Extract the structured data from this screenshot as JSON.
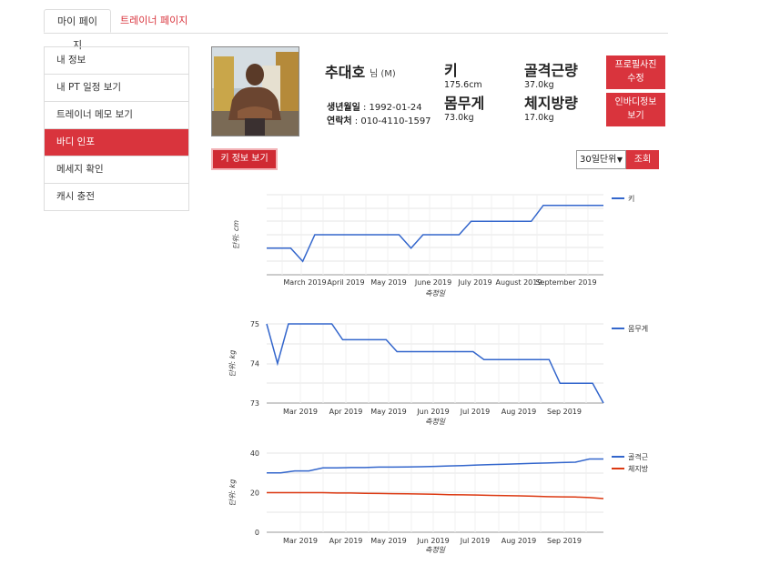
{
  "tabs": {
    "mypage": "마이 페이지",
    "trainer": "트레이너 페이지"
  },
  "sidebar": {
    "items": [
      {
        "label": "내 정보"
      },
      {
        "label": "내 PT 일정 보기"
      },
      {
        "label": "트레이너 메모 보기"
      },
      {
        "label": "바디 인포"
      },
      {
        "label": "메세지 확인"
      },
      {
        "label": "캐시 충전"
      }
    ]
  },
  "profile": {
    "name": "추대호",
    "suffix": "님 (M)",
    "birth_label": "생년월일",
    "birth": " : 1992-01-24",
    "phone_label": "연락처",
    "phone": " : 010-4110-1597"
  },
  "metrics": {
    "height_title": "키",
    "height_value": "175.6cm",
    "muscle_title": "골격근량",
    "muscle_value": "37.0kg",
    "weight_title": "몸무게",
    "weight_value": "73.0kg",
    "fat_title": "체지방량",
    "fat_value": "17.0kg"
  },
  "buttons": {
    "photo_edit_1": "프로필사진",
    "photo_edit_2": "수정",
    "inbody_edit_1": "인바디정보",
    "inbody_edit_2": "보기",
    "view_height": "키 정보 보기",
    "period_select": "30일단위",
    "search": "조회"
  },
  "colors": {
    "accent": "#d9343d",
    "series_blue": "#3366cc",
    "series_red": "#dc3912"
  },
  "icons": {
    "dropdown": "triangle-down-icon"
  },
  "chart_data": [
    {
      "type": "line",
      "ylabel": "단위: cm",
      "xlabel": "측정일",
      "x_ticks": [
        "March 2019",
        "April 2019",
        "May 2019",
        "June 2019",
        "July 2019",
        "August 2019",
        "September 2019"
      ],
      "series": [
        {
          "name": "키",
          "color": "#3366cc",
          "values": [
            174.0,
            174.0,
            174.0,
            173.5,
            174.5,
            174.5,
            174.5,
            174.5,
            174.5,
            174.5,
            174.5,
            174.5,
            174.0,
            174.5,
            174.5,
            174.5,
            174.5,
            175.0,
            175.0,
            175.0,
            175.0,
            175.0,
            175.0,
            175.6,
            175.6,
            175.6,
            175.6,
            175.6,
            175.6
          ]
        }
      ]
    },
    {
      "type": "line",
      "ylabel": "단위: kg",
      "xlabel": "측정일",
      "y_ticks": [
        "75",
        "74",
        "73"
      ],
      "x_ticks": [
        "Mar 2019",
        "Apr 2019",
        "May 2019",
        "Jun 2019",
        "Jul 2019",
        "Aug 2019",
        "Sep 2019"
      ],
      "series": [
        {
          "name": "몸무게",
          "color": "#3366cc",
          "values": [
            75.0,
            74.0,
            75.0,
            75.0,
            75.0,
            75.0,
            75.0,
            74.6,
            74.6,
            74.6,
            74.6,
            74.6,
            74.3,
            74.3,
            74.3,
            74.3,
            74.3,
            74.3,
            74.3,
            74.3,
            74.1,
            74.1,
            74.1,
            74.1,
            74.1,
            74.1,
            74.1,
            73.5,
            73.5,
            73.5,
            73.5,
            73.0
          ]
        }
      ]
    },
    {
      "type": "line",
      "ylabel": "단위: kg",
      "xlabel": "측정일",
      "y_ticks": [
        "40",
        "20",
        "0"
      ],
      "x_ticks": [
        "Mar 2019",
        "Apr 2019",
        "May 2019",
        "Jun 2019",
        "Jul 2019",
        "Aug 2019",
        "Sep 2019"
      ],
      "series": [
        {
          "name": "골격근",
          "color": "#3366cc",
          "values": [
            30.0,
            30.0,
            31.0,
            31.0,
            32.5,
            32.5,
            32.7,
            32.7,
            32.9,
            32.9,
            33.0,
            33.1,
            33.3,
            33.5,
            33.7,
            34.0,
            34.2,
            34.4,
            34.6,
            34.8,
            35.0,
            35.2,
            35.4,
            37.0,
            37.0
          ]
        },
        {
          "name": "체지방",
          "color": "#dc3912",
          "values": [
            20.0,
            20.0,
            20.0,
            20.0,
            20.0,
            19.8,
            19.8,
            19.7,
            19.6,
            19.5,
            19.4,
            19.3,
            19.2,
            19.0,
            18.9,
            18.8,
            18.6,
            18.5,
            18.4,
            18.2,
            18.0,
            17.9,
            17.8,
            17.5,
            17.0
          ]
        }
      ]
    }
  ]
}
